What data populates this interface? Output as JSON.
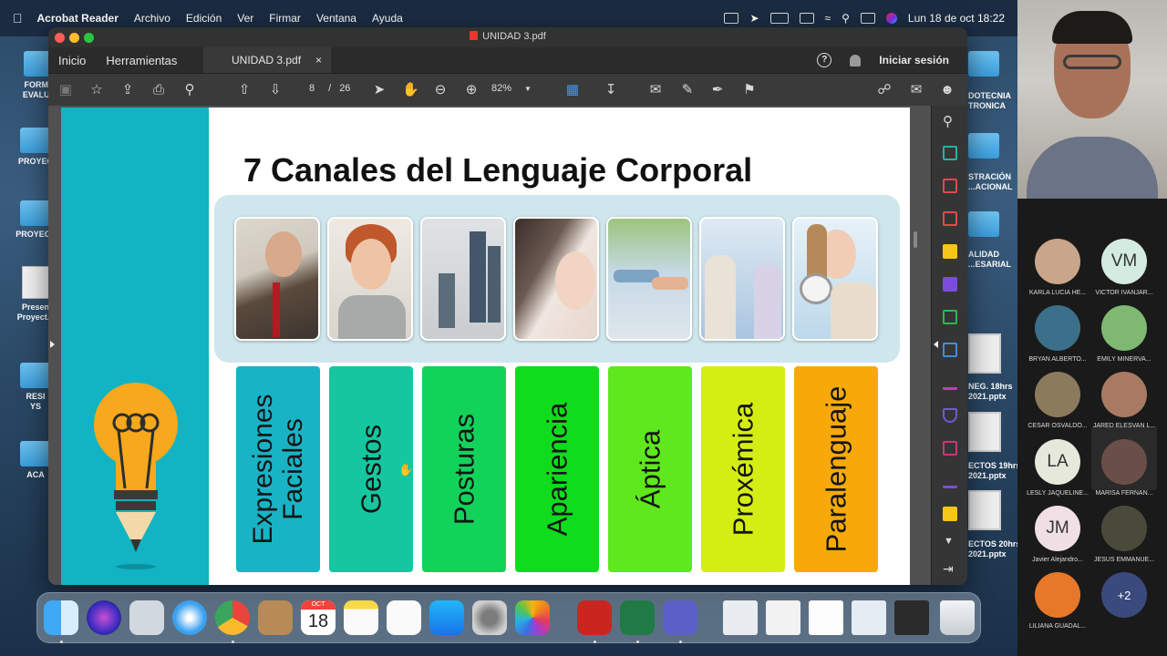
{
  "menubar": {
    "app_name": "Acrobat Reader",
    "menus": [
      "Archivo",
      "Edición",
      "Ver",
      "Firmar",
      "Ventana",
      "Ayuda"
    ],
    "clock": "Lun 18 de oct  18:22"
  },
  "window": {
    "title": "UNIDAD 3.pdf",
    "tabs": {
      "home": "Inicio",
      "tools": "Herramientas",
      "doc": "UNIDAD 3.pdf",
      "close": "×"
    },
    "sign_in": "Iniciar sesión",
    "help": "?"
  },
  "toolbar": {
    "page_current": "8",
    "page_separator": "/",
    "page_total": "26",
    "zoom": "82%"
  },
  "slide": {
    "title": "7 Canales del Lenguaje Corporal",
    "cards": [
      {
        "label": "Expresiones\nFaciales",
        "color": "#18b3c5"
      },
      {
        "label": "Gestos",
        "color": "#15c7a0"
      },
      {
        "label": "Posturas",
        "color": "#12d35a"
      },
      {
        "label": "Apariencia",
        "color": "#0fdc1c"
      },
      {
        "label": "Áptica",
        "color": "#5fe81d"
      },
      {
        "label": "Proxémica",
        "color": "#d4ee13"
      },
      {
        "label": "Paralenguaje",
        "color": "#f7a90a"
      }
    ]
  },
  "desktop_icons": {
    "left": [
      "FORMU\nEVALUA",
      "PROYEC",
      "PROYECT",
      "Presen\nProyect...",
      "RESI\nYS",
      "ACA"
    ],
    "right": [
      "DOTECNIA\nTRONICA",
      "STRACIÓN\n...ACIONAL",
      "ALIDAD\n...ESARIAL",
      "NEG. 18hrs\n2021.pptx",
      "ECTOS 19hrs\n2021.pptx",
      "ECTOS 20hrs\n2021.pptx"
    ]
  },
  "dock": {
    "calendar_month": "OCT",
    "calendar_day": "18"
  },
  "participants": [
    {
      "name": "KARLA LUCIA HE...",
      "initials": "",
      "color": "#c9a58a"
    },
    {
      "name": "VICTOR IVANJAR...",
      "initials": "VM",
      "color": "#d4ecdf"
    },
    {
      "name": "BRYAN ALBERTO...",
      "initials": "",
      "color": "#3c6f8a"
    },
    {
      "name": "EMILY MINERVA...",
      "initials": "",
      "color": "#7fb870"
    },
    {
      "name": "CESAR OSVALDO...",
      "initials": "",
      "color": "#8c7a5c"
    },
    {
      "name": "JARED ELESVAN L...",
      "initials": "",
      "color": "#a87a62"
    },
    {
      "name": "LESLY JAQUELINE...",
      "initials": "LA",
      "color": "#e6e8dc"
    },
    {
      "name": "MARISA FERNAN...",
      "initials": "",
      "color": "#6a4f48"
    },
    {
      "name": "Javier Alejandro...",
      "initials": "JM",
      "color": "#f0e0e6"
    },
    {
      "name": "JESUS EMMANUE...",
      "initials": "",
      "color": "#4a4a3a"
    },
    {
      "name": "LILIANA GUADAL...",
      "initials": "",
      "color": "#e7782a"
    },
    {
      "name": "",
      "initials": "+2",
      "color": "#3a4a7c"
    }
  ]
}
